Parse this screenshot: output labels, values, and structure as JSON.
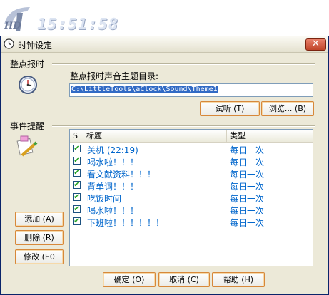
{
  "banner": {
    "logo_text": "HD",
    "clock_time": "15:51:58"
  },
  "window": {
    "title": "时钟设定",
    "close_glyph": "✕"
  },
  "hourly_chime": {
    "section_label": "整点报时",
    "field_label": "整点报时声音主题目录:",
    "path_value": "C:\\LittleTools\\aClock\\Sound\\Theme1",
    "listen_button": "试听 (T)",
    "browse_button": "浏览... (B)"
  },
  "event_reminder": {
    "section_label": "事件提醒",
    "columns": {
      "check": "S",
      "title": "标题",
      "type": "类型"
    },
    "rows": [
      {
        "checked": true,
        "title": "关机 (22:19)",
        "type": "每日一次"
      },
      {
        "checked": true,
        "title": "喝水啦！！！",
        "type": "每日一次"
      },
      {
        "checked": true,
        "title": "看文献资料！！！",
        "type": "每日一次"
      },
      {
        "checked": true,
        "title": "背单词！！！",
        "type": "每日一次"
      },
      {
        "checked": true,
        "title": "吃饭时间",
        "type": "每日一次"
      },
      {
        "checked": true,
        "title": "喝水啦！！！",
        "type": "每日一次"
      },
      {
        "checked": true,
        "title": "下班啦！！！！！！",
        "type": "每日一次"
      }
    ],
    "add_button": "添加 (A)",
    "delete_button": "删除 (R)",
    "edit_button": "修改 (E0"
  },
  "footer": {
    "ok_button": "确定 (O)",
    "cancel_button": "取消 (C)",
    "help_button": "帮助 (H)"
  },
  "colors": {
    "list_text": "#0066cc",
    "dialog_bg": "#ece9d8",
    "selection": "#316ac5",
    "button_border": "#d7883a"
  }
}
